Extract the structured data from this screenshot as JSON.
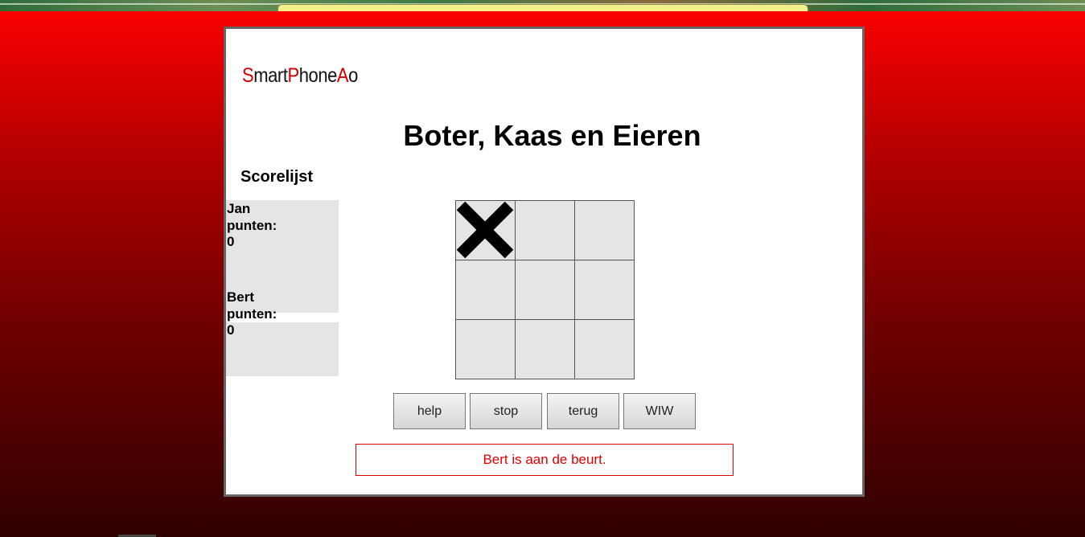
{
  "logo": {
    "parts": [
      {
        "text": "S",
        "accent": true
      },
      {
        "text": "mart",
        "accent": false
      },
      {
        "text": "P",
        "accent": true
      },
      {
        "text": "hone",
        "accent": false
      },
      {
        "text": "A",
        "accent": true
      },
      {
        "text": "o",
        "accent": false
      }
    ]
  },
  "title": "Boter, Kaas en Eieren",
  "scoreboard": {
    "heading": "Scorelijst",
    "players": [
      {
        "name": "Jan",
        "label": "punten:",
        "points": "0"
      },
      {
        "name": "Bert",
        "label": "punten:",
        "points": "0"
      }
    ]
  },
  "board": {
    "cells": [
      "X",
      "",
      "",
      "",
      "",
      "",
      "",
      "",
      ""
    ]
  },
  "buttons": {
    "help": "help",
    "stop": "stop",
    "back": "terug",
    "wiw": "WIW"
  },
  "status": "Bert is aan de beurt.",
  "colors": {
    "accent": "#d40000",
    "cell": "#e5e5e5",
    "status": "#e00000"
  }
}
